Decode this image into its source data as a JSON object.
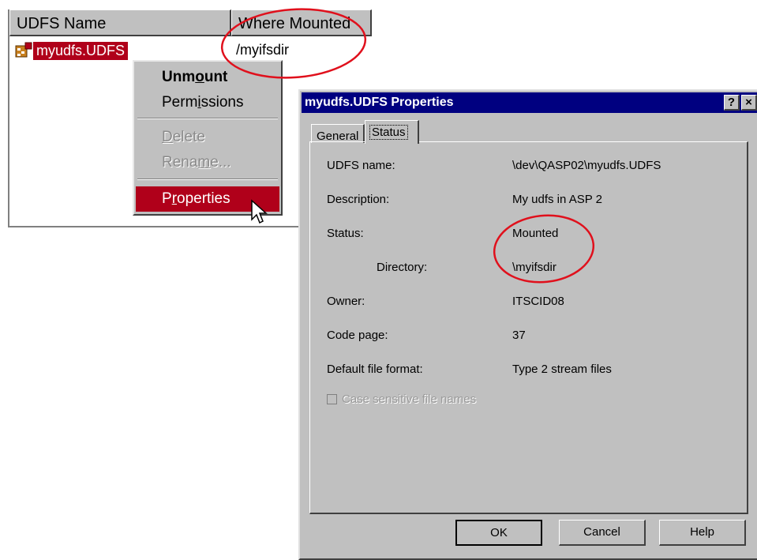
{
  "listview": {
    "headers": {
      "name": "UDFS Name",
      "where": "Where Mounted"
    },
    "row": {
      "name": "myudfs.UDFS",
      "where": "/myifsdir"
    }
  },
  "context_menu": {
    "items": [
      {
        "label": "Unmount",
        "accel": "o",
        "state": "default-bold"
      },
      {
        "label": "Permissions",
        "accel": "i",
        "state": "enabled"
      },
      {
        "label": "Delete",
        "accel": "D",
        "state": "disabled"
      },
      {
        "label": "Rename...",
        "accel": "m",
        "state": "disabled"
      },
      {
        "label": "Properties",
        "accel": "r",
        "state": "selected"
      }
    ]
  },
  "dialog": {
    "title": "myudfs.UDFS Properties",
    "help_glyph": "?",
    "close_glyph": "×",
    "tabs": [
      {
        "label": "General",
        "active": false
      },
      {
        "label": "Status",
        "active": true
      }
    ],
    "fields": {
      "udfs_name": {
        "label": "UDFS name:",
        "value": "\\dev\\QASP02\\myudfs.UDFS"
      },
      "description": {
        "label": "Description:",
        "value": "My udfs in ASP 2"
      },
      "status": {
        "label": "Status:",
        "value": "Mounted"
      },
      "directory": {
        "label": "Directory:",
        "value": "\\myifsdir"
      },
      "owner": {
        "label": "Owner:",
        "value": "ITSCID08"
      },
      "code_page": {
        "label": "Code page:",
        "value": "37"
      },
      "default_format": {
        "label": "Default file format:",
        "value": "Type 2 stream files"
      }
    },
    "case_sensitive": {
      "label": "Case sensitive file names",
      "checked": false,
      "enabled": false
    },
    "buttons": {
      "ok": "OK",
      "cancel": "Cancel",
      "help": "Help"
    }
  },
  "colors": {
    "selection": "#b0001a",
    "titlebar": "#000080",
    "annotation": "#e0101c",
    "face": "#c0c0c0"
  }
}
